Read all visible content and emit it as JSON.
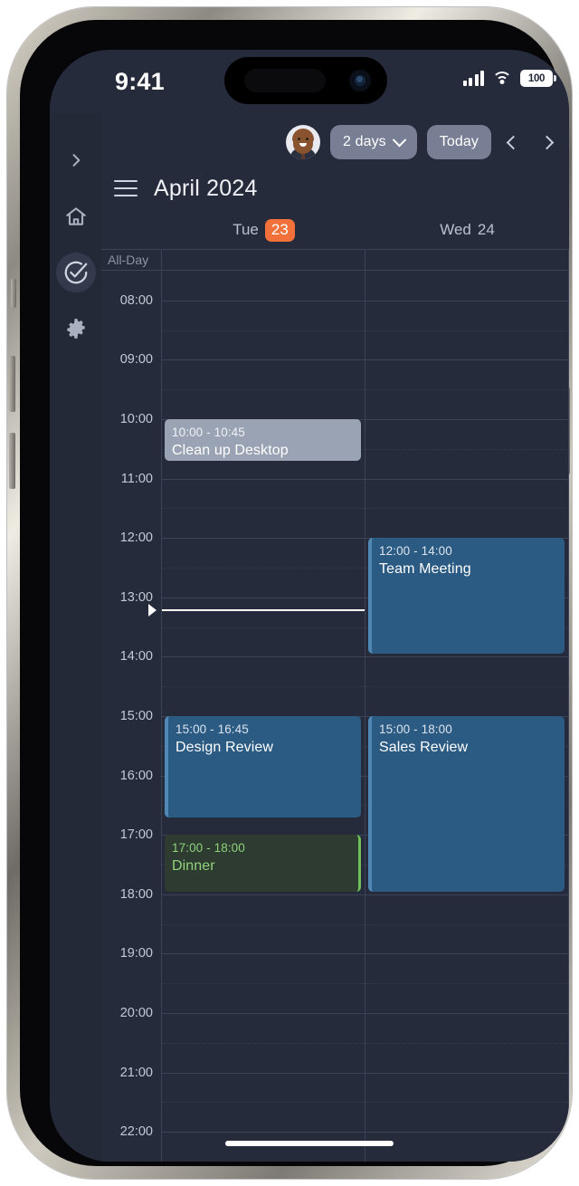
{
  "status_bar": {
    "time": "9:41",
    "battery_level": "100",
    "signal_icon": "cellular-signal-icon",
    "wifi_icon": "wifi-icon",
    "battery_icon": "battery-icon"
  },
  "rail": {
    "items": [
      {
        "icon": "chevron-right-icon",
        "name": "expand-sidebar",
        "active": false
      },
      {
        "icon": "home-icon",
        "name": "home",
        "active": false
      },
      {
        "icon": "check-circle-icon",
        "name": "tasks",
        "active": true
      },
      {
        "icon": "gear-icon",
        "name": "settings",
        "active": false
      }
    ]
  },
  "toolbar": {
    "avatar_label": "user-avatar",
    "range_label": "2 days",
    "range_chevron": "chevron-down-icon",
    "today_label": "Today",
    "prev_label": "chevron-left-icon",
    "next_label": "chevron-right-icon"
  },
  "header": {
    "menu_icon": "hamburger-menu-icon",
    "month_title": "April 2024"
  },
  "calendar": {
    "all_day_label": "All-Day",
    "days": [
      {
        "weekday": "Tue",
        "daynum": "23",
        "is_today": true
      },
      {
        "weekday": "Wed",
        "daynum": "24",
        "is_today": false
      }
    ],
    "hours": [
      "08:00",
      "09:00",
      "10:00",
      "11:00",
      "12:00",
      "13:00",
      "14:00",
      "15:00",
      "16:00",
      "17:00",
      "18:00",
      "19:00",
      "20:00",
      "21:00",
      "22:00"
    ],
    "start_hour": 7.5,
    "end_hour": 22.5,
    "now_time": 13.2,
    "today_accent": "#f2713a",
    "events": [
      {
        "day": 0,
        "time": "10:00 - 10:45",
        "title": "Clean up Desktop",
        "start": 10.0,
        "end": 10.75,
        "style": "gray"
      },
      {
        "day": 1,
        "time": "12:00 - 14:00",
        "title": "Team Meeting",
        "start": 12.0,
        "end": 14.0,
        "style": "blue"
      },
      {
        "day": 0,
        "time": "15:00 - 16:45",
        "title": "Design Review",
        "start": 15.0,
        "end": 16.75,
        "style": "blue"
      },
      {
        "day": 1,
        "time": "15:00 - 18:00",
        "title": "Sales Review",
        "start": 15.0,
        "end": 18.0,
        "style": "blue"
      },
      {
        "day": 0,
        "time": "17:00 - 18:00",
        "title": "Dinner",
        "start": 17.0,
        "end": 18.0,
        "style": "green"
      }
    ]
  }
}
